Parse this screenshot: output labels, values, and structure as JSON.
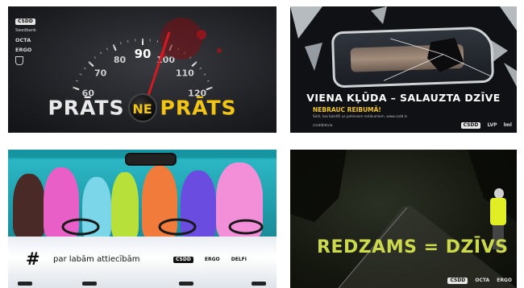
{
  "tiles": {
    "prats": {
      "sponsors": [
        "CSDD",
        "Swedbank",
        "OCTA",
        "ERGO"
      ],
      "speed_ticks": [
        "60",
        "70",
        "80",
        "90",
        "100",
        "110",
        "120"
      ],
      "word_left": "PRĀTS",
      "word_mid": "NE",
      "word_right": "PRĀTS"
    },
    "viena": {
      "headline": "VIENA KĻŪDA – SALAUZTA DZĪVE",
      "subhead": "NEBRAUC REIBUMĀ!",
      "fineprint": "Sēdi, kas balstīti uz patiesiem notikumiem. www.csdd.lv",
      "handle": "/csddlatvia",
      "logos": [
        "CSDD",
        "LVP",
        "lml"
      ]
    },
    "labam": {
      "hash": "#",
      "slogan": "par labām attiecībām",
      "logos": [
        "CSDD",
        "ERGO",
        "DELFI"
      ]
    },
    "redzams": {
      "headline": "REDZAMS = DZĪVS",
      "logos": [
        "CSDD",
        "OCTA",
        "ERGO"
      ]
    }
  },
  "colors": {
    "yellow": "#f2c515",
    "lime": "#cbd94b",
    "teal": "#1fa9b7"
  }
}
